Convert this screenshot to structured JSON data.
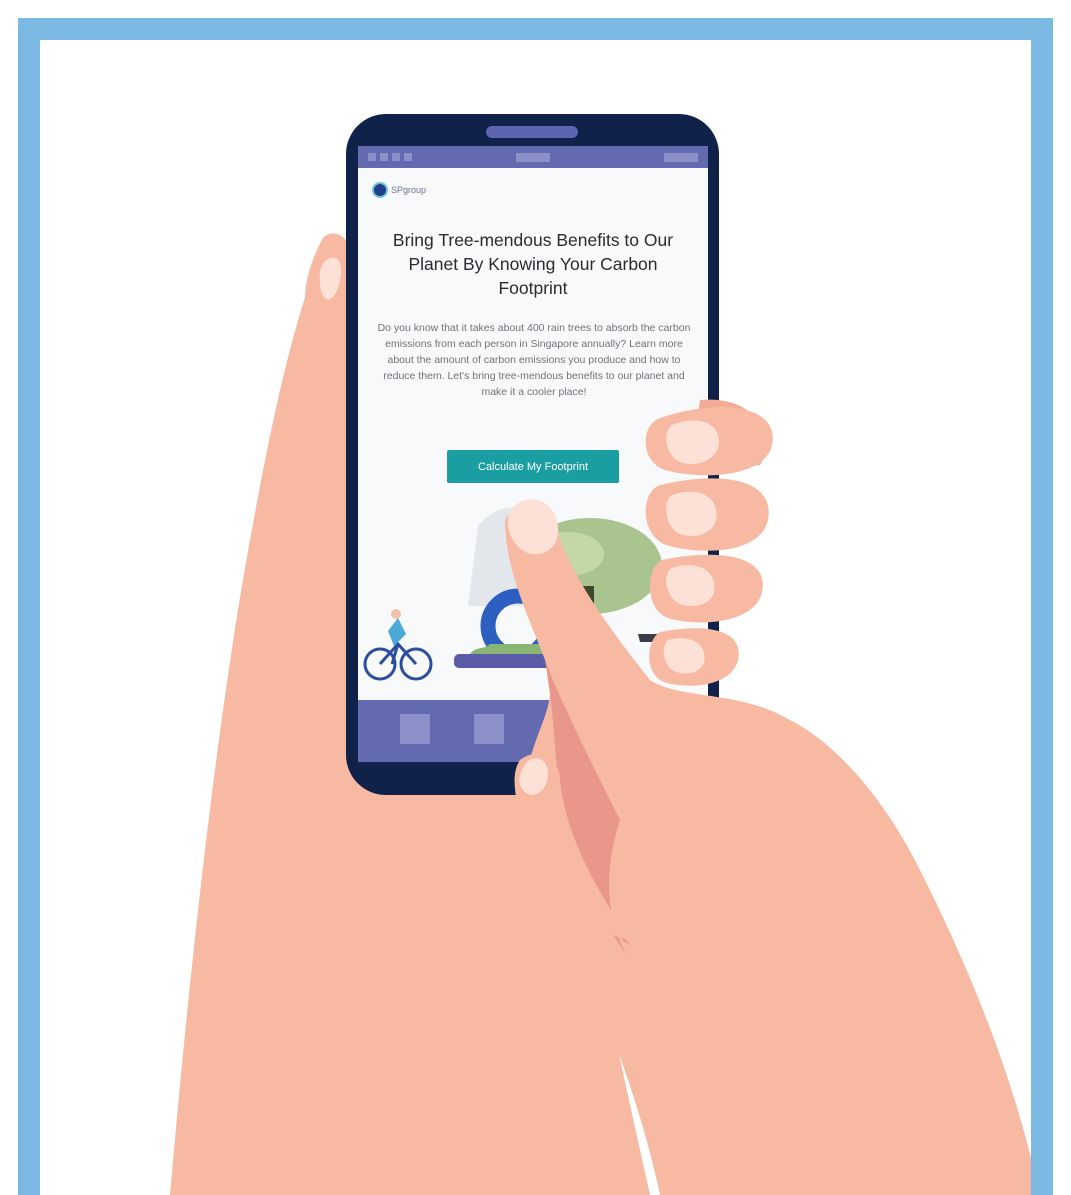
{
  "app": {
    "logo_text": "SPgroup"
  },
  "hero": {
    "title": "Bring Tree-mendous Benefits to Our Planet By Knowing Your Carbon Footprint",
    "body": "Do you know that it takes about 400 rain trees to absorb the carbon emissions from each person in Singapore annually? Learn more about the amount of carbon emissions you produce and how to reduce them. Let's bring tree-mendous benefits to our planet and make it a cooler place!",
    "cta_label": "Calculate My Footprint"
  },
  "colors": {
    "frame_border": "#7bb9e2",
    "phone_body": "#11224a",
    "bars": "#636aaf",
    "cta": "#1a9ea1",
    "skin": "#f8b9a3",
    "skin_shadow": "#e9978a",
    "nail": "#fde0d6"
  },
  "icons": {
    "logo": "sp-group-logo-icon",
    "illustration": "park-illustration",
    "bottom_nav": [
      "nav-placeholder-icon",
      "nav-placeholder-icon",
      "nav-placeholder-icon"
    ]
  }
}
